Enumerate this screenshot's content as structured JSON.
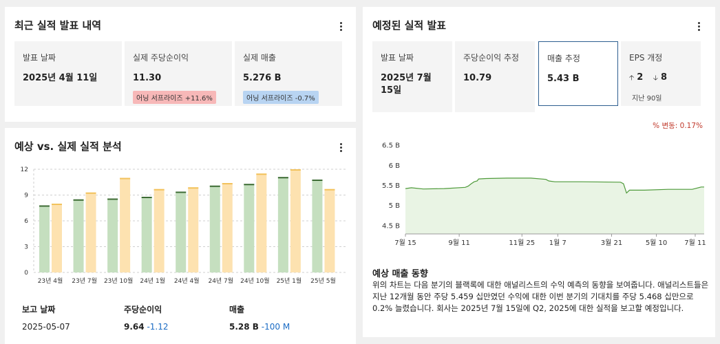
{
  "recent": {
    "title": "최근 실적 발표 내역",
    "cells": [
      {
        "label": "발표 날짜",
        "value": "2025년 4월 11일"
      },
      {
        "label": "실제 주당순이익",
        "value": "11.30",
        "badge": "어닝 서프라이즈 +11.6%"
      },
      {
        "label": "실제 매출",
        "value": "5.276 B",
        "badge": "어닝 서프라이즈 -0.7%"
      }
    ]
  },
  "analysis": {
    "title": "예상 vs. 실제 실적 분석",
    "table": {
      "headers": [
        "보고 날짜",
        "주당순이익",
        "매출"
      ],
      "rows": [
        {
          "date": "2025-05-07",
          "eps": "9.64",
          "eps_change": "-1.12",
          "rev": "5.28 B",
          "rev_change": "-100 M"
        }
      ]
    }
  },
  "scheduled": {
    "title": "예정된 실적 발표",
    "cells": [
      {
        "label": "발표 날짜",
        "value_line1": "2025년 7월",
        "value_line2": "15일"
      },
      {
        "label": "주당순이익 추정",
        "value": "10.79"
      },
      {
        "label": "매출 추정",
        "value": "5.43 B"
      },
      {
        "label": "EPS 개정",
        "up": "2",
        "down": "8",
        "sub": "지난 90일"
      }
    ],
    "change_label": "% 변동: 0.17%",
    "trend_title": "예상 매출 동향",
    "trend_text": "위의 차트는 다음 분기의 블랙록에 대한 애널리스트의 수익 예측의 동향을 보여줍니다. 애널리스트들은 지난 12개월 동안 주당 5.459 십만였던 수익에 대한 이번 분기의 기대치를 주당 5.468 십만으로 0.2% 늘렸습니다. 회사는 2025년 7월 15일에 Q2, 2025에 대한 실적을 보고할 예정입니다."
  },
  "colors": {
    "actual": "#c5dfbf",
    "actual_top": "#3d6b34",
    "estimate": "#fde2b0",
    "estimate_top": "#f2c25c",
    "line": "#4e9a3a",
    "area": "#e9f4e4",
    "selected_border": "#2c5d8f"
  },
  "chart_data": [
    {
      "type": "bar",
      "categories": [
        "23년 4월",
        "23년 7월",
        "23년 10월",
        "24년 1월",
        "24년 4월",
        "24년 7월",
        "24년 10월",
        "25년 1월",
        "25년 5월"
      ],
      "yticks": [
        "0",
        "3",
        "6",
        "9",
        "12"
      ],
      "ylim": [
        0,
        12
      ],
      "series": [
        {
          "values": [
            7.8,
            8.5,
            8.6,
            8.8,
            9.4,
            10.1,
            10.3,
            11.1,
            10.8
          ]
        },
        {
          "values": [
            8.0,
            9.3,
            11.0,
            9.7,
            9.9,
            10.4,
            11.5,
            12.0,
            9.7
          ]
        }
      ],
      "legend": "none",
      "grid": true
    },
    {
      "type": "area",
      "xticks": [
        "7월 15",
        "9월 11",
        "11월 25",
        "1월 7",
        "3월 21",
        "5월 10",
        "7월 11"
      ],
      "yticks": [
        "4.5 B",
        "5 B",
        "5.5 B",
        "6 B",
        "6.5 B"
      ],
      "ylim": [
        4.3,
        6.7
      ],
      "points": [
        [
          0,
          5.43
        ],
        [
          0.02,
          5.45
        ],
        [
          0.06,
          5.42
        ],
        [
          0.13,
          5.43
        ],
        [
          0.2,
          5.46
        ],
        [
          0.21,
          5.49
        ],
        [
          0.22,
          5.55
        ],
        [
          0.23,
          5.6
        ],
        [
          0.24,
          5.62
        ],
        [
          0.245,
          5.67
        ],
        [
          0.27,
          5.68
        ],
        [
          0.34,
          5.69
        ],
        [
          0.42,
          5.69
        ],
        [
          0.47,
          5.66
        ],
        [
          0.48,
          5.62
        ],
        [
          0.5,
          5.6
        ],
        [
          0.59,
          5.6
        ],
        [
          0.72,
          5.59
        ],
        [
          0.73,
          5.55
        ],
        [
          0.74,
          5.32
        ],
        [
          0.75,
          5.39
        ],
        [
          0.8,
          5.39
        ],
        [
          0.88,
          5.41
        ],
        [
          0.96,
          5.41
        ],
        [
          0.99,
          5.47
        ],
        [
          1.0,
          5.47
        ]
      ]
    }
  ]
}
